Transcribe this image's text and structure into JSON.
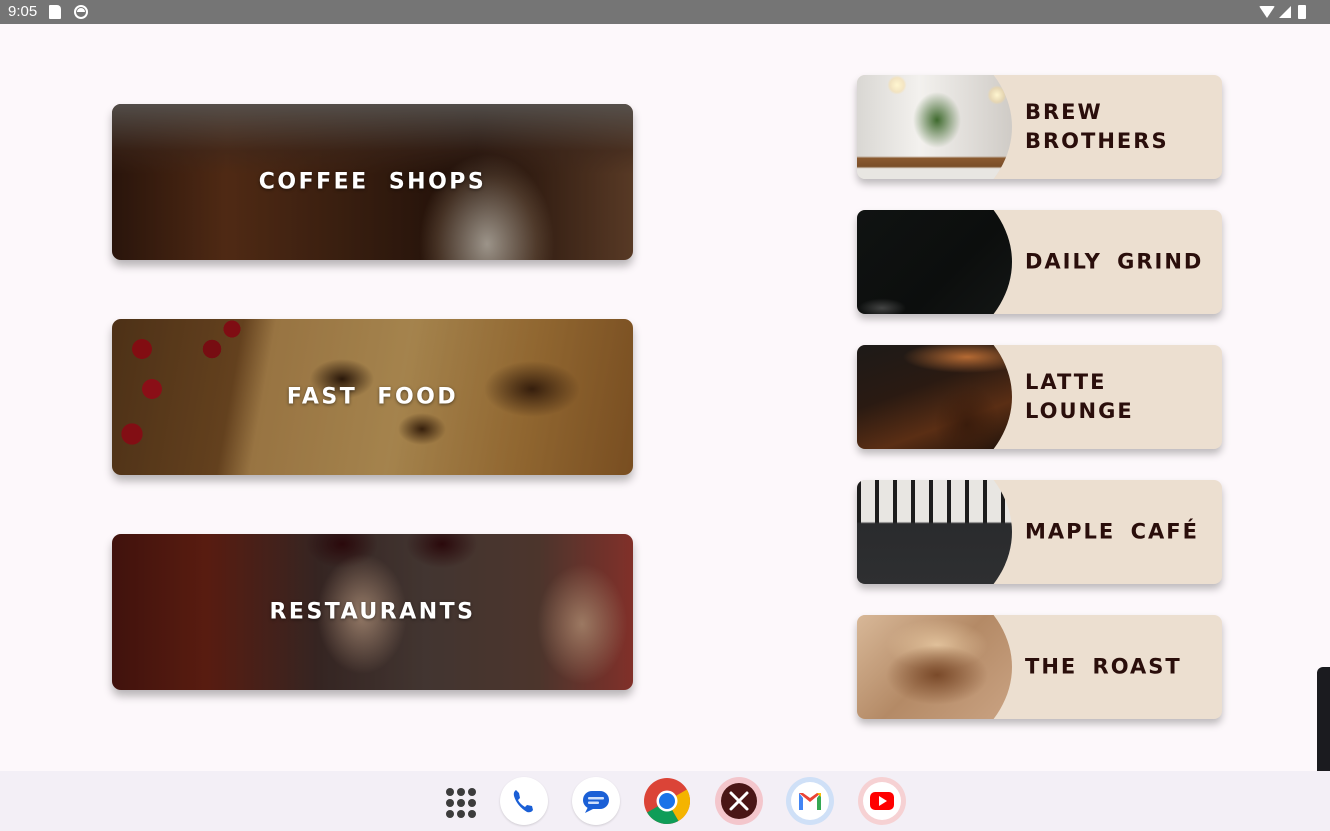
{
  "status_bar": {
    "time": "9:05",
    "icons": [
      "sd-card-icon",
      "app-circle-icon",
      "wifi-icon",
      "signal-icon",
      "battery-icon"
    ]
  },
  "categories": [
    {
      "label": "COFFEE SHOPS"
    },
    {
      "label": "FAST FOOD"
    },
    {
      "label": "RESTAURANTS"
    }
  ],
  "places": [
    {
      "label": "BREW BROTHERS"
    },
    {
      "label": "DAILY GRIND"
    },
    {
      "label": "LATTE LOUNGE"
    },
    {
      "label": "MAPLE CAFÉ"
    },
    {
      "label": "THE ROAST"
    }
  ],
  "dock": {
    "apps": [
      "app-drawer-icon",
      "phone-icon",
      "messages-icon",
      "chrome-icon",
      "restaurant-app-icon",
      "gmail-icon",
      "youtube-icon"
    ]
  },
  "colors": {
    "background": "#fdf8fb",
    "place_card": "#ecdfd0",
    "place_text": "#2a0e0b",
    "status_bar": "#757575",
    "taskbar": "#f3eff6"
  }
}
